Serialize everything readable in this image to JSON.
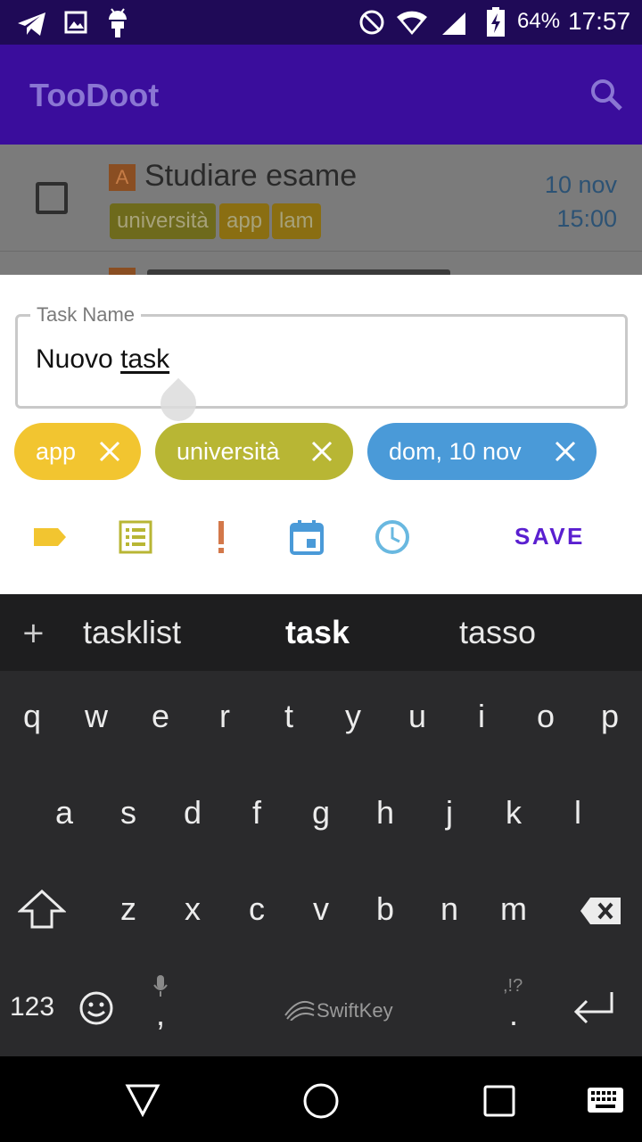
{
  "status_bar": {
    "battery": "64%",
    "time": "17:57",
    "icons": [
      "telegram-icon",
      "image-icon",
      "android-icon",
      "do-not-disturb-icon",
      "wifi-icon",
      "signal-icon",
      "battery-charging-icon"
    ]
  },
  "app_bar": {
    "title": "TooDoot",
    "search_icon": "search-icon"
  },
  "task_list": {
    "items": [
      {
        "priority": "A",
        "name": "Studiare esame",
        "tags": [
          {
            "label": "università",
            "color": "#6e6a1c"
          },
          {
            "label": "app",
            "color": "#8a6e12"
          },
          {
            "label": "lam",
            "color": "#8a6e12"
          }
        ],
        "date": "10 nov",
        "time": "15:00"
      }
    ]
  },
  "sheet": {
    "field_label": "Task Name",
    "field_value_plain": "Nuovo ",
    "field_value_underlined": "task",
    "chips": [
      {
        "label": "app",
        "color": "#f2c530"
      },
      {
        "label": "università",
        "color": "#b8b634"
      },
      {
        "label": "dom, 10 nov",
        "color": "#4a9ad8"
      }
    ],
    "tools": [
      "tag-icon",
      "list-icon",
      "priority-icon",
      "calendar-icon",
      "clock-icon"
    ],
    "save_label": "SAVE"
  },
  "keyboard": {
    "suggestions": [
      "tasklist",
      "task",
      "tasso"
    ],
    "row1": [
      "q",
      "w",
      "e",
      "r",
      "t",
      "y",
      "u",
      "i",
      "o",
      "p"
    ],
    "row2": [
      "a",
      "s",
      "d",
      "f",
      "g",
      "h",
      "j",
      "k",
      "l"
    ],
    "row3": [
      "z",
      "x",
      "c",
      "v",
      "b",
      "n",
      "m"
    ],
    "numbers_key": "123",
    "comma_key": ",",
    "period_key": ".",
    "punct_hint": ",!?",
    "brand": "SwiftKey"
  },
  "nav_bar": {
    "icons": [
      "back-icon",
      "home-icon",
      "recents-icon",
      "keyboard-icon"
    ]
  },
  "colors": {
    "status_bar": "#1f0a57",
    "app_bar": "#3a0d9c",
    "save": "#5a1fd0",
    "keyboard_bg": "#2a2a2c"
  }
}
